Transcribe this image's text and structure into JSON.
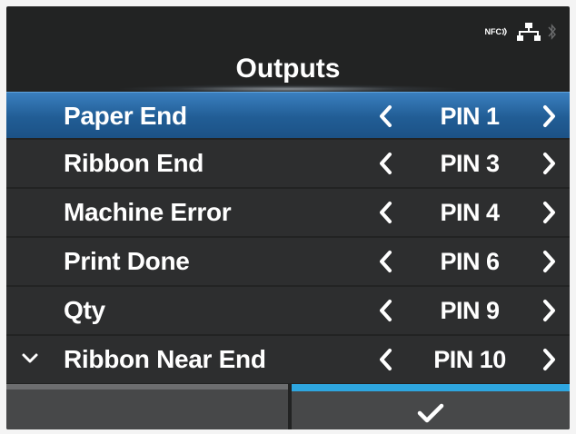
{
  "status": {
    "nfc_label": "NFC",
    "icons": [
      "nfc-icon",
      "network-icon",
      "bluetooth-icon"
    ]
  },
  "title": "Outputs",
  "rows": [
    {
      "label": "Paper End",
      "value": "PIN 1",
      "selected": true
    },
    {
      "label": "Ribbon End",
      "value": "PIN 3"
    },
    {
      "label": "Machine Error",
      "value": "PIN 4"
    },
    {
      "label": "Print Done",
      "value": "PIN 6"
    },
    {
      "label": "Qty",
      "value": "PIN 9"
    },
    {
      "label": "Ribbon Near End",
      "value": "PIN 10"
    }
  ],
  "buttons": {
    "ok_icon": "checkmark-icon"
  },
  "colors": {
    "selection": "#215d95",
    "accent": "#2ea6e0",
    "background": "#222323"
  }
}
